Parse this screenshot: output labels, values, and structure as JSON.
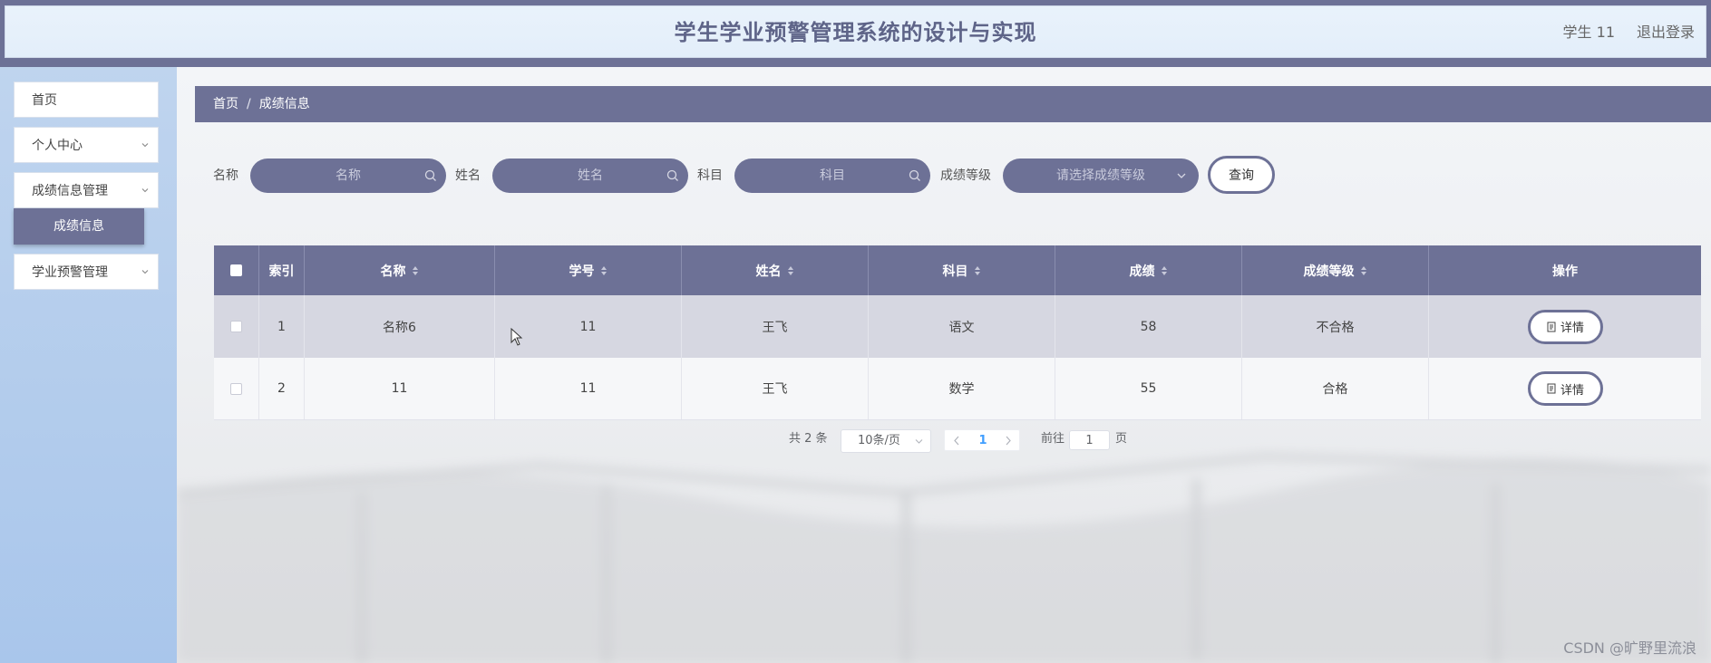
{
  "header": {
    "title": "学生学业预警管理系统的设计与实现",
    "user": "学生 11",
    "logout": "退出登录"
  },
  "sidebar": {
    "items": [
      {
        "label": "首页"
      },
      {
        "label": "个人中心"
      },
      {
        "label": "成绩信息管理"
      },
      {
        "label": "学业预警管理"
      }
    ],
    "active_sub": "成绩信息"
  },
  "breadcrumb": {
    "home": "首页",
    "sep": "/",
    "current": "成绩信息"
  },
  "search": {
    "name_label": "名称",
    "name_placeholder": "名称",
    "student_label": "姓名",
    "student_placeholder": "姓名",
    "subject_label": "科目",
    "subject_placeholder": "科目",
    "grade_label": "成绩等级",
    "grade_placeholder": "请选择成绩等级",
    "query_button": "查询"
  },
  "table": {
    "headers": [
      "索引",
      "名称",
      "学号",
      "姓名",
      "科目",
      "成绩",
      "成绩等级",
      "操作"
    ],
    "rows": [
      {
        "index": "1",
        "name": "名称6",
        "student_id": "11",
        "student_name": "王飞",
        "subject": "语文",
        "score": "58",
        "level": "不合格",
        "action": "详情"
      },
      {
        "index": "2",
        "name": "11",
        "student_id": "11",
        "student_name": "王飞",
        "subject": "数学",
        "score": "55",
        "level": "合格",
        "action": "详情"
      }
    ]
  },
  "pagination": {
    "total": "共 2 条",
    "page_size": "10条/页",
    "current_page": "1",
    "goto_label": "前往",
    "goto_value": "1",
    "page_suffix": "页"
  },
  "watermark": "CSDN @旷野里流浪",
  "colors": {
    "primary": "#6d7196",
    "active_page": "#409eff"
  }
}
